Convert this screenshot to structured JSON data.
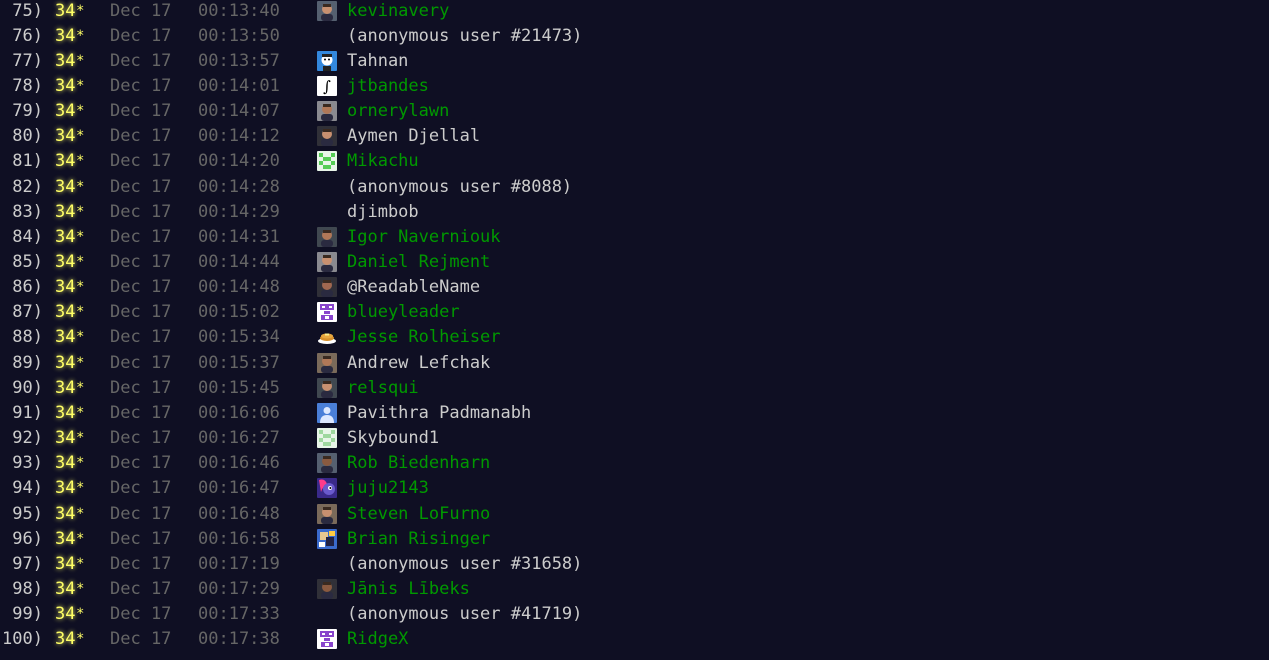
{
  "colors": {
    "background": "#0f0f23",
    "score": "#ffff66",
    "link": "#009900",
    "text": "#cccccc",
    "muted": "#666666"
  },
  "leaderboard": {
    "entries": [
      {
        "rank": "75)",
        "score": "34",
        "star": "*",
        "date": "Dec 17",
        "time": "00:13:40",
        "name": "kevinavery",
        "linked": true,
        "avatar": "photo-avatar-icon"
      },
      {
        "rank": "76)",
        "score": "34",
        "star": "*",
        "date": "Dec 17",
        "time": "00:13:50",
        "name": "(anonymous user #21473)",
        "linked": false,
        "avatar": ""
      },
      {
        "rank": "77)",
        "score": "34",
        "star": "*",
        "date": "Dec 17",
        "time": "00:13:57",
        "name": "Tahnan",
        "linked": false,
        "avatar": "cartoon-face-icon"
      },
      {
        "rank": "78)",
        "score": "34",
        "star": "*",
        "date": "Dec 17",
        "time": "00:14:01",
        "name": "jtbandes",
        "linked": true,
        "avatar": "integral-sign-icon"
      },
      {
        "rank": "79)",
        "score": "34",
        "star": "*",
        "date": "Dec 17",
        "time": "00:14:07",
        "name": "ornerylawn",
        "linked": true,
        "avatar": "photo-avatar-icon"
      },
      {
        "rank": "80)",
        "score": "34",
        "star": "*",
        "date": "Dec 17",
        "time": "00:14:12",
        "name": "Aymen Djellal",
        "linked": false,
        "avatar": "photo-avatar-icon"
      },
      {
        "rank": "81)",
        "score": "34",
        "star": "*",
        "date": "Dec 17",
        "time": "00:14:20",
        "name": "Mikachu",
        "linked": true,
        "avatar": "identicon-icon"
      },
      {
        "rank": "82)",
        "score": "34",
        "star": "*",
        "date": "Dec 17",
        "time": "00:14:28",
        "name": "(anonymous user #8088)",
        "linked": false,
        "avatar": ""
      },
      {
        "rank": "83)",
        "score": "34",
        "star": "*",
        "date": "Dec 17",
        "time": "00:14:29",
        "name": "djimbob",
        "linked": false,
        "avatar": ""
      },
      {
        "rank": "84)",
        "score": "34",
        "star": "*",
        "date": "Dec 17",
        "time": "00:14:31",
        "name": "Igor Navernіouk",
        "linked": true,
        "avatar": "photo-avatar-icon"
      },
      {
        "rank": "85)",
        "score": "34",
        "star": "*",
        "date": "Dec 17",
        "time": "00:14:44",
        "name": "Daniel Rejment",
        "linked": true,
        "avatar": "photo-avatar-icon"
      },
      {
        "rank": "86)",
        "score": "34",
        "star": "*",
        "date": "Dec 17",
        "time": "00:14:48",
        "name": "@ReadableName",
        "linked": false,
        "avatar": "photo-avatar-icon"
      },
      {
        "rank": "87)",
        "score": "34",
        "star": "*",
        "date": "Dec 17",
        "time": "00:15:02",
        "name": "blueyleader",
        "linked": true,
        "avatar": "pixel-robot-icon"
      },
      {
        "rank": "88)",
        "score": "34",
        "star": "*",
        "date": "Dec 17",
        "time": "00:15:34",
        "name": "Jesse Rolheiser",
        "linked": true,
        "avatar": "pancakes-icon"
      },
      {
        "rank": "89)",
        "score": "34",
        "star": "*",
        "date": "Dec 17",
        "time": "00:15:37",
        "name": "Andrew Lefchak",
        "linked": false,
        "avatar": "photo-avatar-icon"
      },
      {
        "rank": "90)",
        "score": "34",
        "star": "*",
        "date": "Dec 17",
        "time": "00:15:45",
        "name": "relsqui",
        "linked": true,
        "avatar": "photo-avatar-icon"
      },
      {
        "rank": "91)",
        "score": "34",
        "star": "*",
        "date": "Dec 17",
        "time": "00:16:06",
        "name": "Pavithra Padmanabh",
        "linked": false,
        "avatar": "default-person-icon"
      },
      {
        "rank": "92)",
        "score": "34",
        "star": "*",
        "date": "Dec 17",
        "time": "00:16:27",
        "name": "Skybound1",
        "linked": false,
        "avatar": "identicon-icon"
      },
      {
        "rank": "93)",
        "score": "34",
        "star": "*",
        "date": "Dec 17",
        "time": "00:16:46",
        "name": "Rob Biedenharn",
        "linked": true,
        "avatar": "photo-avatar-icon"
      },
      {
        "rank": "94)",
        "score": "34",
        "star": "*",
        "date": "Dec 17",
        "time": "00:16:47",
        "name": "juju2143",
        "linked": true,
        "avatar": "pony-avatar-icon"
      },
      {
        "rank": "95)",
        "score": "34",
        "star": "*",
        "date": "Dec 17",
        "time": "00:16:48",
        "name": "Steven LoFurno",
        "linked": true,
        "avatar": "photo-avatar-icon"
      },
      {
        "rank": "96)",
        "score": "34",
        "star": "*",
        "date": "Dec 17",
        "time": "00:16:58",
        "name": "Brian Risinger",
        "linked": true,
        "avatar": "cartoon-avatar-icon"
      },
      {
        "rank": "97)",
        "score": "34",
        "star": "*",
        "date": "Dec 17",
        "time": "00:17:19",
        "name": "(anonymous user #31658)",
        "linked": false,
        "avatar": ""
      },
      {
        "rank": "98)",
        "score": "34",
        "star": "*",
        "date": "Dec 17",
        "time": "00:17:29",
        "name": "Jānis Lībeks",
        "linked": true,
        "avatar": "photo-avatar-icon"
      },
      {
        "rank": "99)",
        "score": "34",
        "star": "*",
        "date": "Dec 17",
        "time": "00:17:33",
        "name": "(anonymous user #41719)",
        "linked": false,
        "avatar": ""
      },
      {
        "rank": "100)",
        "score": "34",
        "star": "*",
        "date": "Dec 17",
        "time": "00:17:38",
        "name": "RidgeX",
        "linked": true,
        "avatar": "pixel-robot-icon"
      }
    ]
  }
}
